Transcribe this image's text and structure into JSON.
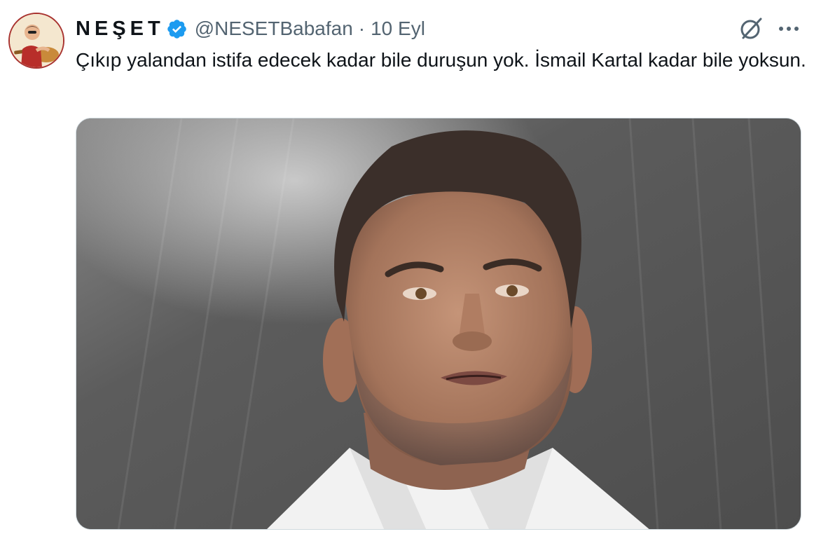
{
  "tweet": {
    "display_name": "NEŞET",
    "handle": "@NESETBabafan",
    "separator": "·",
    "date": "10 Eyl",
    "text": "Çıkıp yalandan istifa edecek kadar bile duruşun yok. İsmail Kartal kadar bile yoksun."
  },
  "icons": {
    "verified": "verified-badge-icon",
    "grok": "grok-icon",
    "more": "more-options-icon"
  },
  "colors": {
    "verified": "#1d9bf0",
    "secondary_text": "#536471",
    "primary_text": "#0f1419",
    "border": "#cfd9de"
  }
}
